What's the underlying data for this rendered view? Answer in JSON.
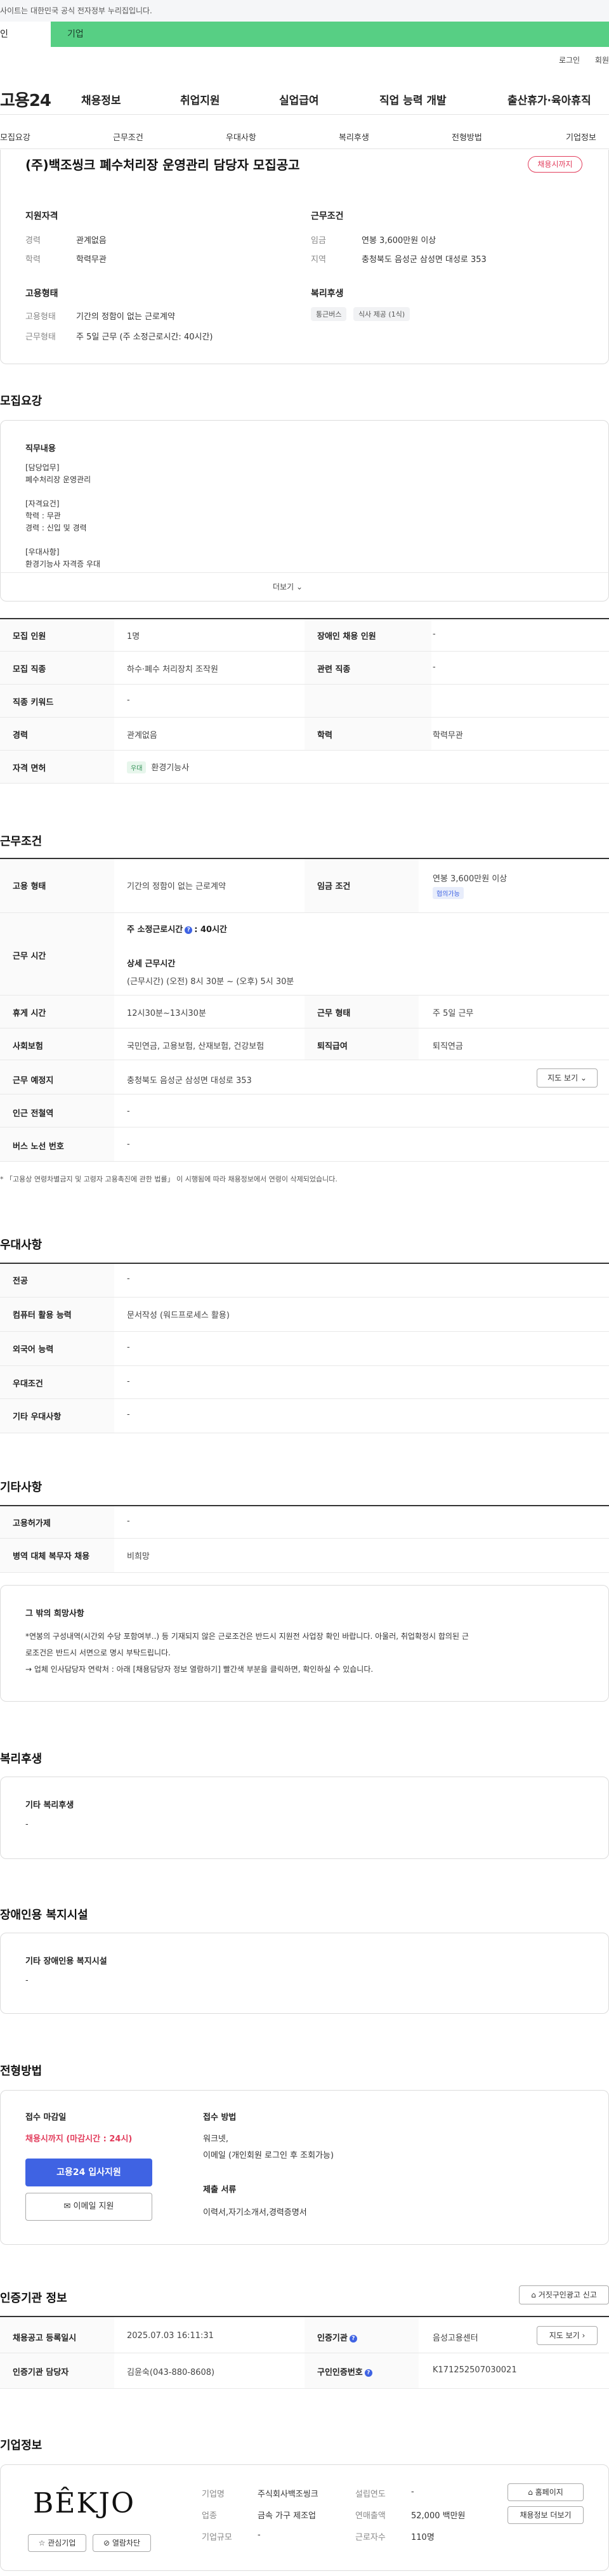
{
  "banner": {
    "text": "사이트는 대한민국 공식 전자정부 누리집입니다."
  },
  "type_tabs": {
    "personal": "인",
    "company": "기업"
  },
  "util": {
    "login": "로그인",
    "join": "회원"
  },
  "gnb": {
    "logo": "고용24",
    "items": [
      "채용정보",
      "취업지원",
      "실업급여",
      "직업 능력 개발",
      "출산휴가·육아휴직"
    ]
  },
  "subnav": [
    "모집요강",
    "근무조건",
    "우대사항",
    "복리후생",
    "전형방법",
    "기업정보"
  ],
  "job": {
    "title": "(주)백조씽크 폐수처리장 운영관리 담당자 모집공고",
    "badge": "채용시까지"
  },
  "summary": {
    "qual_title": "지원자격",
    "career_label": "경력",
    "career_value": "관계없음",
    "edu_label": "학력",
    "edu_value": "학력무관",
    "work_title": "근무조건",
    "wage_label": "임금",
    "wage_value": "연봉 3,600만원 이상",
    "region_label": "지역",
    "region_value": "충청북도 음성군 삼성면 대성로 353",
    "emp_title": "고용형태",
    "emp_type_label": "고용형태",
    "emp_type_value": "기간의 정함이 없는 근로계약",
    "work_form_label": "근무형태",
    "work_form_value": "주 5일 근무 (주 소정근로시간: 40시간)",
    "welfare_title": "복리후생",
    "welfare_chips": [
      "통근버스",
      "식사 제공 (1식)"
    ]
  },
  "recruit": {
    "section_title": "모집요강",
    "duty_title": "직무내용",
    "duty_text": "[담당업무]\n폐수처리장 운영관리\n\n[자격요건]\n학력 : 무관\n경력 : 신입 및 경력\n\n[우대사항]\n환경기능사 자격증 우대",
    "more_label": "더보기",
    "rows": {
      "headcount_label": "모집 인원",
      "headcount_value": "1명",
      "disabled_label": "장애인 채용 인원",
      "disabled_value": "-",
      "job_label": "모집 직종",
      "job_value": "하수·폐수 처리장치 조작원",
      "related_label": "관련 직종",
      "related_value": "-",
      "keyword_label": "직종 키워드",
      "keyword_value": "-",
      "career_label": "경력",
      "career_value": "관계없음",
      "edu_label": "학력",
      "edu_value": "학력무관",
      "license_label": "자격 면허",
      "license_chip": "우대",
      "license_value": "환경기능사"
    }
  },
  "conditions": {
    "section_title": "근무조건",
    "emp_label": "고용 형태",
    "emp_value": "기간의 정함이 없는 근로계약",
    "wage_label": "임금 조건",
    "wage_value": "연봉 3,600만원 이상",
    "wage_chip": "협의가능",
    "hours_label": "근무 시간",
    "hours_main": "주 소정근로시간",
    "hours_main_value": ": 40시간",
    "hours_detail_title": "상세 근무시간",
    "hours_detail": "(근무시간) (오전) 8시 30분 ~ (오후) 5시 30분",
    "break_label": "휴게 시간",
    "break_value": "12시30분~13시30분",
    "form_label": "근무 형태",
    "form_value": "주 5일 근무",
    "insurance_label": "사회보험",
    "insurance_value": "국민연금, 고용보험, 산재보험, 건강보험",
    "severance_label": "퇴직급여",
    "severance_value": "퇴직연금",
    "place_label": "근무 예정지",
    "place_value": "충청북도 음성군 삼성면 대성로 353",
    "map_button": "지도 보기",
    "subway_label": "인근 전철역",
    "subway_value": "-",
    "bus_label": "버스 노선 번호",
    "bus_value": "-",
    "note": "「고용상 연령차별금지 및 고령자 고용촉진에 관한 법률」 이 시행됨에 따라 채용정보에서 연령이 삭제되었습니다."
  },
  "preference": {
    "section_title": "우대사항",
    "major_label": "전공",
    "major_value": "-",
    "computer_label": "컴퓨터 활용 능력",
    "computer_value": "문서작성 (워드프로세스 활용)",
    "language_label": "외국어 능력",
    "language_value": "-",
    "condition_label": "우대조건",
    "condition_value": "-",
    "other_label": "기타 우대사항",
    "other_value": "-"
  },
  "etc": {
    "section_title": "기타사항",
    "insurance_label": "고용허가제",
    "insurance_value": "-",
    "military_label": "병역 대체 복무자 채용",
    "military_value": "비희망",
    "other_title": "그 밖의 희망사항",
    "other_text_1": "*연봉의 구성내역(시간외 수당 포함여부..) 등 기재되지 않은 근로조건은 반드시 지원전 사업장 확인 바랍니다. 아울러, 취업확정시 합의된 근",
    "other_text_2": "로조건은 반드시 서면으로 명시 부탁드립니다.",
    "other_text_3": "→ 업체 인사담당자 연락처 : 아래 [채용담당자 정보 열람하기] 빨간색 부분을 클릭하면, 확인하실 수 있습니다."
  },
  "welfare": {
    "section_title": "복리후생",
    "other_title": "기타 복리후생",
    "other_value": "-"
  },
  "disabled_facility": {
    "section_title": "장애인용 복지시설",
    "title": "기타 장애인용 복지시설",
    "value": "-"
  },
  "apply": {
    "section_title": "전형방법",
    "deadline_title": "접수 마감일",
    "deadline_value": "채용시까지 (마감시간 : 24시)",
    "apply_button": "고용24 입사지원",
    "email_button": "이메일 지원",
    "method_title": "접수 방법",
    "method_value_1": "워크넷,",
    "method_value_2": "이메일 (개인회원 로그인 후 조회가능)",
    "docs_title": "제출 서류",
    "docs_value": "이력서,자기소개서,경력증명서"
  },
  "agency": {
    "section_title": "인증기관 정보",
    "report_button": "거짓구인광고 신고",
    "reg_label": "채용공고 등록일시",
    "reg_value": "2025.07.03 16:11:31",
    "agency_label": "인증기관",
    "agency_value": "음성고용센터",
    "map_button": "지도 보기",
    "manager_label": "인증기관 담당자",
    "manager_value": "김윤숙(043-880-8608)",
    "number_label": "구인인증번호",
    "number_value": "K171252507030021"
  },
  "company": {
    "section_title": "기업정보",
    "logo_text": "BÊKJO",
    "interest_button": "관심기업",
    "block_button": "열람차단",
    "name_label": "기업명",
    "name_value": "주식회사백조씽크",
    "founded_label": "설립연도",
    "founded_value": "-",
    "industry_label": "업종",
    "industry_value": "금속 가구 제조업",
    "sales_label": "연매출액",
    "sales_value": "52,000 백만원",
    "size_label": "기업규모",
    "size_value": "-",
    "workers_label": "근로자수",
    "workers_value": "110명",
    "homepage_button": "홈페이지",
    "jobs_button": "채용정보 더보기"
  }
}
